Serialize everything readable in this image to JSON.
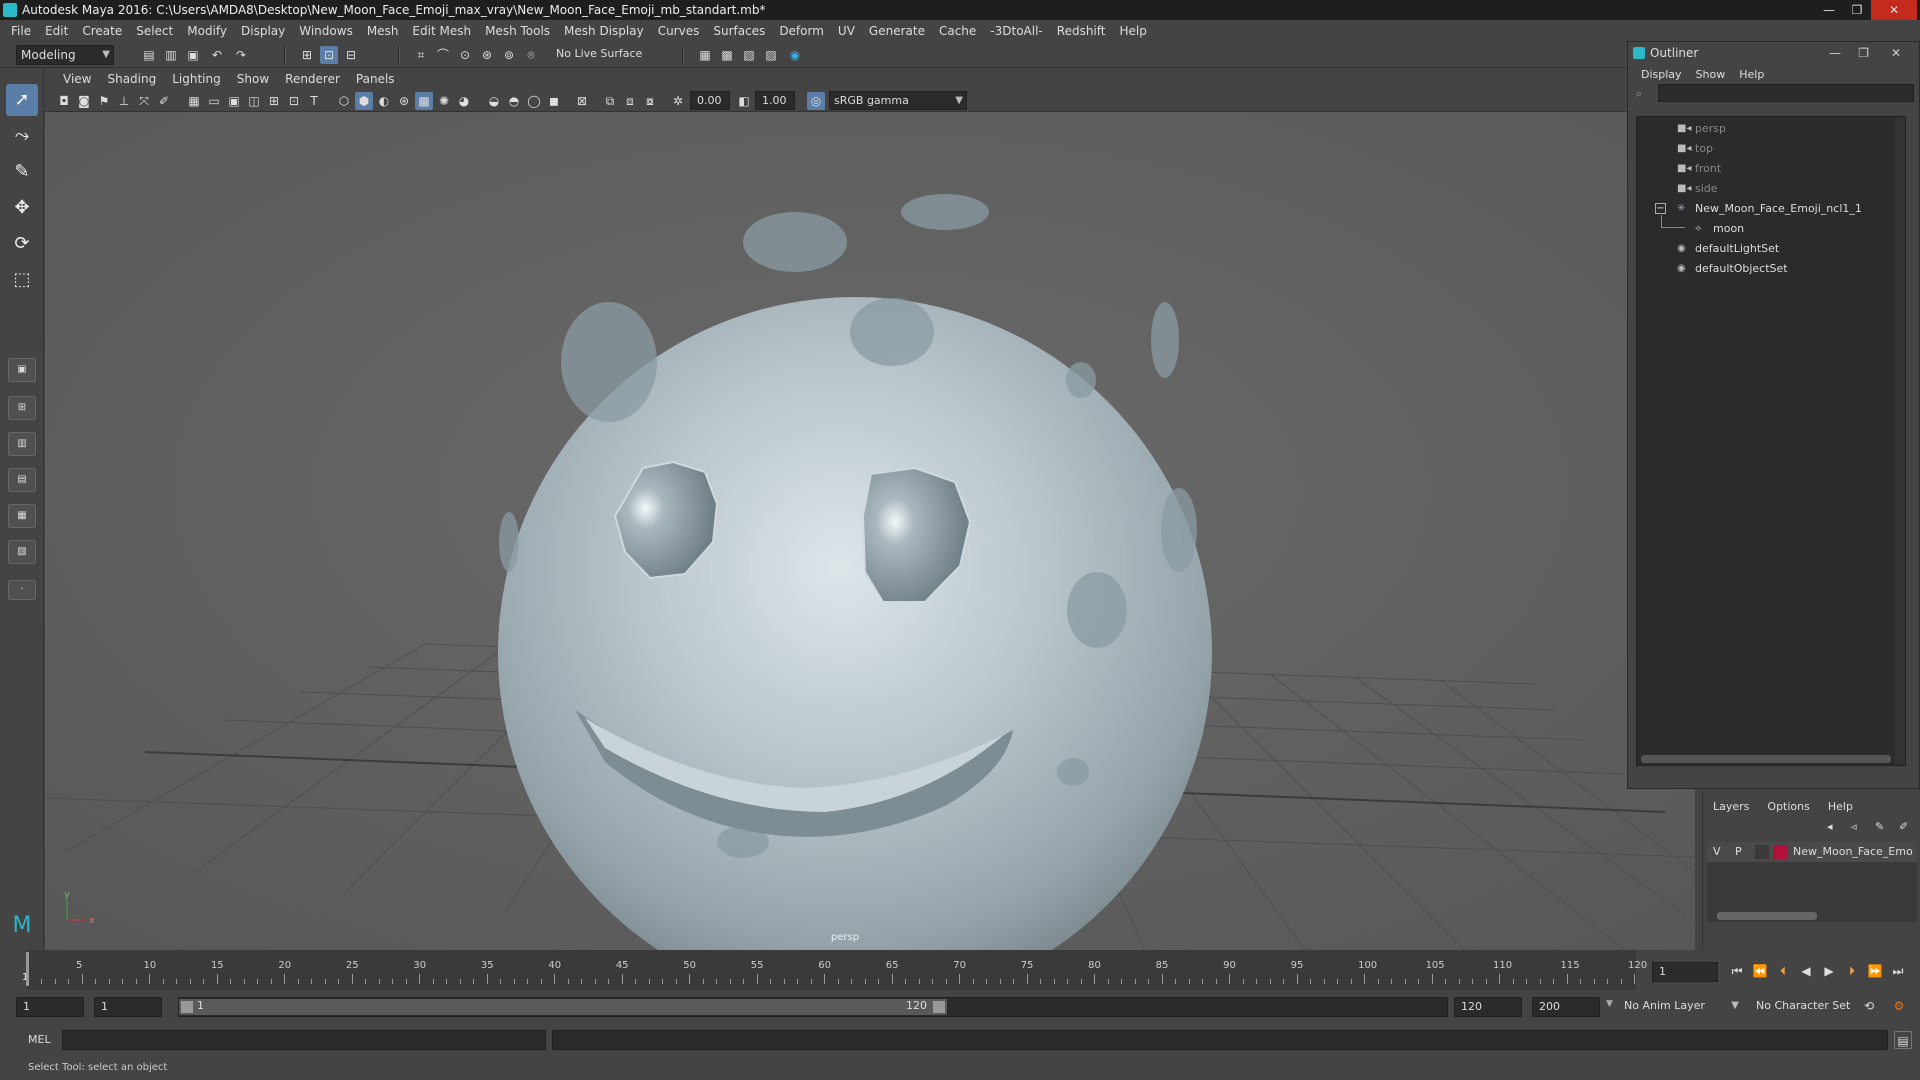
{
  "window": {
    "title": "Autodesk Maya 2016: C:\\Users\\AMDA8\\Desktop\\New_Moon_Face_Emoji_max_vray\\New_Moon_Face_Emoji_mb_standart.mb*"
  },
  "menubar": [
    "File",
    "Edit",
    "Create",
    "Select",
    "Modify",
    "Display",
    "Windows",
    "Mesh",
    "Edit Mesh",
    "Mesh Tools",
    "Mesh Display",
    "Curves",
    "Surfaces",
    "Deform",
    "UV",
    "Generate",
    "Cache",
    "-3DtoAll-",
    "Redshift",
    "Help"
  ],
  "shelf": {
    "mode": "Modeling",
    "live_surface": "No Live Surface"
  },
  "panel": {
    "menu": [
      "View",
      "Shading",
      "Lighting",
      "Show",
      "Renderer",
      "Panels"
    ],
    "exposure": "0.00",
    "gamma": "1.00",
    "color_space": "sRGB gamma",
    "camera_label": "persp"
  },
  "outliner": {
    "title": "Outliner",
    "menu": [
      "Display",
      "Show",
      "Help"
    ],
    "items": [
      {
        "label": "persp",
        "icon": "camera-icon",
        "dim": true
      },
      {
        "label": "top",
        "icon": "camera-icon",
        "dim": true
      },
      {
        "label": "front",
        "icon": "camera-icon",
        "dim": true
      },
      {
        "label": "side",
        "icon": "camera-icon",
        "dim": true
      },
      {
        "label": "New_Moon_Face_Emoji_ncl1_1",
        "icon": "group-icon",
        "dim": false
      },
      {
        "label": "moon",
        "icon": "mesh-icon",
        "dim": false
      },
      {
        "label": "defaultLightSet",
        "icon": "set-icon",
        "dim": false
      },
      {
        "label": "defaultObjectSet",
        "icon": "set-icon",
        "dim": false
      }
    ]
  },
  "layers": {
    "menu": [
      "Layers",
      "Options",
      "Help"
    ],
    "layer": {
      "v": "V",
      "p": "P",
      "name": "New_Moon_Face_Emo",
      "color": "#b0103a"
    }
  },
  "timeline": {
    "ticks": [
      "5",
      "10",
      "15",
      "20",
      "25",
      "30",
      "35",
      "40",
      "45",
      "50",
      "55",
      "60",
      "65",
      "70",
      "75",
      "80",
      "85",
      "90",
      "95",
      "100",
      "105",
      "110",
      "115",
      "120"
    ],
    "start_tick": "1",
    "current_frame": "1"
  },
  "range": {
    "start": "1",
    "playback_start": "1",
    "slider_start": "1",
    "slider_end": "120",
    "playback_end": "120",
    "end": "200",
    "anim_layer": "No Anim Layer",
    "character_set": "No Character Set"
  },
  "cmd": {
    "label": "MEL"
  },
  "help_line": "Select Tool: select an object",
  "colors": {
    "accent": "#5b7ea8",
    "viewport": "#5e5e5e",
    "layer_color": "#b0103a"
  }
}
